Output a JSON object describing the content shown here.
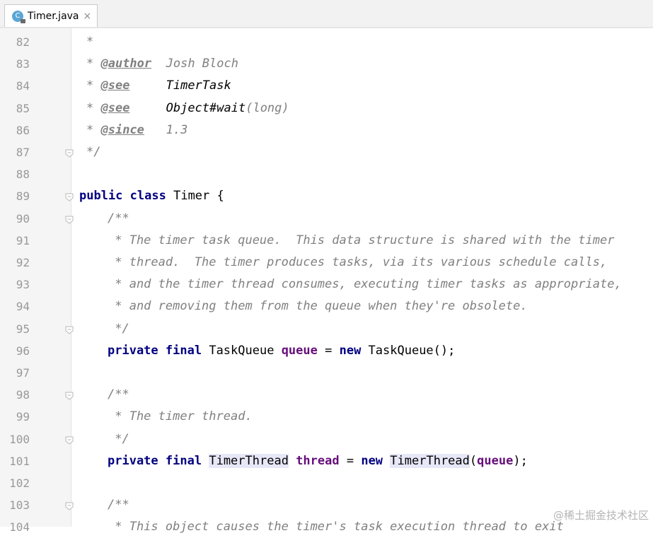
{
  "tab": {
    "title": "Timer.java",
    "icon": "c-class-icon",
    "close": "×",
    "icon_letter": "C"
  },
  "lines": [
    {
      "n": "82",
      "fold": false
    },
    {
      "n": "83",
      "fold": false
    },
    {
      "n": "84",
      "fold": false
    },
    {
      "n": "85",
      "fold": false
    },
    {
      "n": "86",
      "fold": false
    },
    {
      "n": "87",
      "fold": true
    },
    {
      "n": "88",
      "fold": false
    },
    {
      "n": "89",
      "fold": true
    },
    {
      "n": "90",
      "fold": true
    },
    {
      "n": "91",
      "fold": false
    },
    {
      "n": "92",
      "fold": false
    },
    {
      "n": "93",
      "fold": false
    },
    {
      "n": "94",
      "fold": false
    },
    {
      "n": "95",
      "fold": true
    },
    {
      "n": "96",
      "fold": false
    },
    {
      "n": "97",
      "fold": false
    },
    {
      "n": "98",
      "fold": true
    },
    {
      "n": "99",
      "fold": false
    },
    {
      "n": "100",
      "fold": true
    },
    {
      "n": "101",
      "fold": false
    },
    {
      "n": "102",
      "fold": false
    },
    {
      "n": "103",
      "fold": true
    },
    {
      "n": "104",
      "fold": false
    }
  ],
  "code": {
    "l82": "*",
    "l83_star": "* ",
    "l83_tag": "@author",
    "l83_val": "  Josh Bloch",
    "l84_star": "* ",
    "l84_tag": "@see",
    "l84_val": "     TimerTask",
    "l85_star": "* ",
    "l85_tag": "@see",
    "l85_val_a": "     Object",
    "l85_val_b": "#wait",
    "l85_val_c": "(long)",
    "l86_star": "* ",
    "l86_tag": "@since",
    "l86_val": "   1.3",
    "l87": "*/",
    "l89_kw1": "public",
    "l89_kw2": "class",
    "l89_rest": " Timer {",
    "l90": "/**",
    "l91": " * The timer task queue.  This data structure is shared with the timer",
    "l92": " * thread.  The timer produces tasks, via its various schedule calls,",
    "l93": " * and the timer thread consumes, executing timer tasks as appropriate,",
    "l94": " * and removing them from the queue when they're obsolete.",
    "l95": " */",
    "l96_kw1": "private",
    "l96_kw2": "final",
    "l96_type": " TaskQueue ",
    "l96_field": "queue",
    "l96_eq": " = ",
    "l96_new": "new",
    "l96_ctor": " TaskQueue();",
    "l98": "/**",
    "l99": " * The timer thread.",
    "l100": " */",
    "l101_kw1": "private",
    "l101_kw2": "final",
    "l101_type": "TimerThread",
    "l101_field": "thread",
    "l101_eq": " = ",
    "l101_new": "new",
    "l101_ctor": "TimerThread",
    "l101_open": "(",
    "l101_arg": "queue",
    "l101_close": ");",
    "l103": "/**",
    "l104": " * This object causes the timer's task execution thread to exit"
  },
  "watermark": "@稀土掘金技术社区",
  "colors": {
    "keyword": "#000080",
    "field": "#660e7a",
    "comment": "#808080",
    "highlight": "#e6e7f7"
  }
}
